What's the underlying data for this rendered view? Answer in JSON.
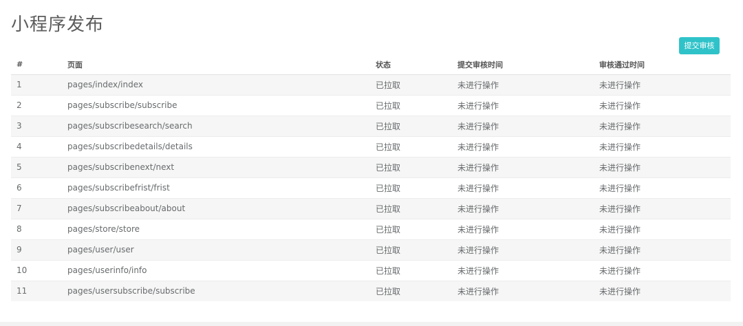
{
  "header": {
    "title": "小程序发布",
    "submit_button": "提交审核"
  },
  "table": {
    "columns": {
      "num": "#",
      "page": "页面",
      "status": "状态",
      "submit_time": "提交审核时间",
      "pass_time": "审核通过时间"
    },
    "rows": [
      {
        "num": "1",
        "page": "pages/index/index",
        "status": "已拉取",
        "submit_time": "未进行操作",
        "pass_time": "未进行操作"
      },
      {
        "num": "2",
        "page": "pages/subscribe/subscribe",
        "status": "已拉取",
        "submit_time": "未进行操作",
        "pass_time": "未进行操作"
      },
      {
        "num": "3",
        "page": "pages/subscribesearch/search",
        "status": "已拉取",
        "submit_time": "未进行操作",
        "pass_time": "未进行操作"
      },
      {
        "num": "4",
        "page": "pages/subscribedetails/details",
        "status": "已拉取",
        "submit_time": "未进行操作",
        "pass_time": "未进行操作"
      },
      {
        "num": "5",
        "page": "pages/subscribenext/next",
        "status": "已拉取",
        "submit_time": "未进行操作",
        "pass_time": "未进行操作"
      },
      {
        "num": "6",
        "page": "pages/subscribefrist/frist",
        "status": "已拉取",
        "submit_time": "未进行操作",
        "pass_time": "未进行操作"
      },
      {
        "num": "7",
        "page": "pages/subscribeabout/about",
        "status": "已拉取",
        "submit_time": "未进行操作",
        "pass_time": "未进行操作"
      },
      {
        "num": "8",
        "page": "pages/store/store",
        "status": "已拉取",
        "submit_time": "未进行操作",
        "pass_time": "未进行操作"
      },
      {
        "num": "9",
        "page": "pages/user/user",
        "status": "已拉取",
        "submit_time": "未进行操作",
        "pass_time": "未进行操作"
      },
      {
        "num": "10",
        "page": "pages/userinfo/info",
        "status": "已拉取",
        "submit_time": "未进行操作",
        "pass_time": "未进行操作"
      },
      {
        "num": "11",
        "page": "pages/usersubscribe/subscribe",
        "status": "已拉取",
        "submit_time": "未进行操作",
        "pass_time": "未进行操作"
      }
    ]
  },
  "colors": {
    "accent": "#2fc3c9",
    "stripe": "#f6f6f6",
    "text": "#676a6c"
  }
}
